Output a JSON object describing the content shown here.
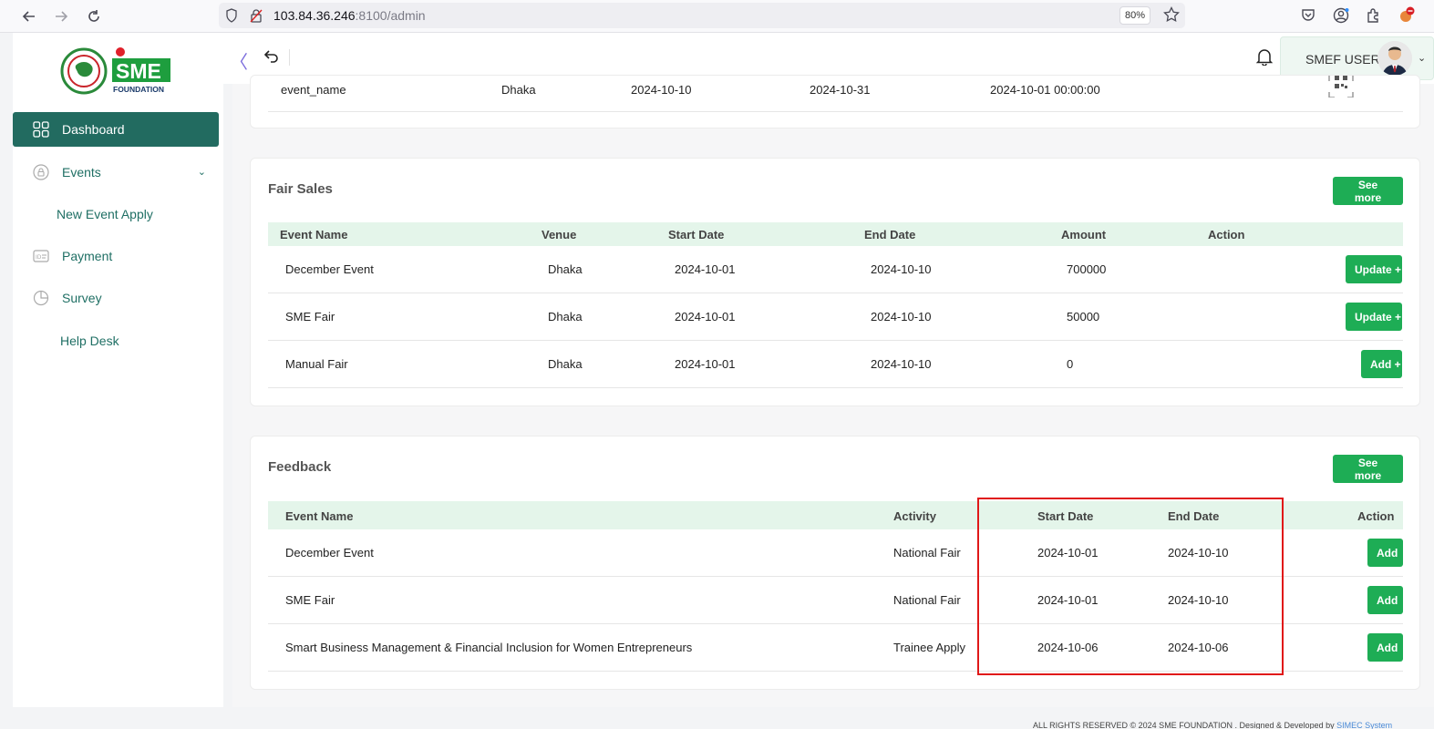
{
  "browser": {
    "url_host": "103.84.36.246",
    "url_rest": ":8100/admin",
    "zoom": "80%"
  },
  "sidebar": {
    "items": [
      {
        "label": "Dashboard",
        "icon": "grid-icon",
        "active": true
      },
      {
        "label": "Events",
        "icon": "lock-icon",
        "has_children": true
      },
      {
        "label": "New Event Apply",
        "icon": "",
        "sub": true
      },
      {
        "label": "Payment",
        "icon": "id-card-icon"
      },
      {
        "label": "Survey",
        "icon": "pie-chart-icon"
      },
      {
        "label": "Help Desk",
        "icon": ""
      }
    ]
  },
  "topbar": {
    "user_name": "SMEF USER"
  },
  "events_partial": {
    "row": {
      "name": "event_name",
      "venue": "Dhaka",
      "start": "2024-10-10",
      "end": "2024-10-31",
      "created": "2024-10-01 00:00:00"
    }
  },
  "fair_sales": {
    "title": "Fair Sales",
    "see_more": "See more",
    "columns": [
      "Event Name",
      "Venue",
      "Start Date",
      "End Date",
      "Amount",
      "Action"
    ],
    "rows": [
      {
        "name": "December Event",
        "venue": "Dhaka",
        "start": "2024-10-01",
        "end": "2024-10-10",
        "amount": "700000",
        "action": "Update +"
      },
      {
        "name": "SME Fair",
        "venue": "Dhaka",
        "start": "2024-10-01",
        "end": "2024-10-10",
        "amount": "50000",
        "action": "Update +"
      },
      {
        "name": "Manual Fair",
        "venue": "Dhaka",
        "start": "2024-10-01",
        "end": "2024-10-10",
        "amount": "0",
        "action": "Add +"
      }
    ]
  },
  "feedback": {
    "title": "Feedback",
    "see_more": "See more",
    "columns": [
      "Event Name",
      "Activity",
      "Start Date",
      "End Date",
      "Action"
    ],
    "rows": [
      {
        "name": "December Event",
        "activity": "National Fair",
        "start": "2024-10-01",
        "end": "2024-10-10",
        "action": "Add"
      },
      {
        "name": "SME Fair",
        "activity": "National Fair",
        "start": "2024-10-01",
        "end": "2024-10-10",
        "action": "Add"
      },
      {
        "name": "Smart Business Management & Financial Inclusion for Women Entrepreneurs",
        "activity": "Trainee Apply",
        "start": "2024-10-06",
        "end": "2024-10-06",
        "action": "Add"
      }
    ]
  },
  "footer": {
    "text": "ALL RIGHTS RESERVED © 2024 SME FOUNDATION . Designed & Developed by",
    "link": "SIMEC System"
  },
  "colors": {
    "sidebar_active": "#226b60",
    "button_green": "#1ead55",
    "table_header": "#e4f5ea",
    "highlight": "#e01818"
  }
}
